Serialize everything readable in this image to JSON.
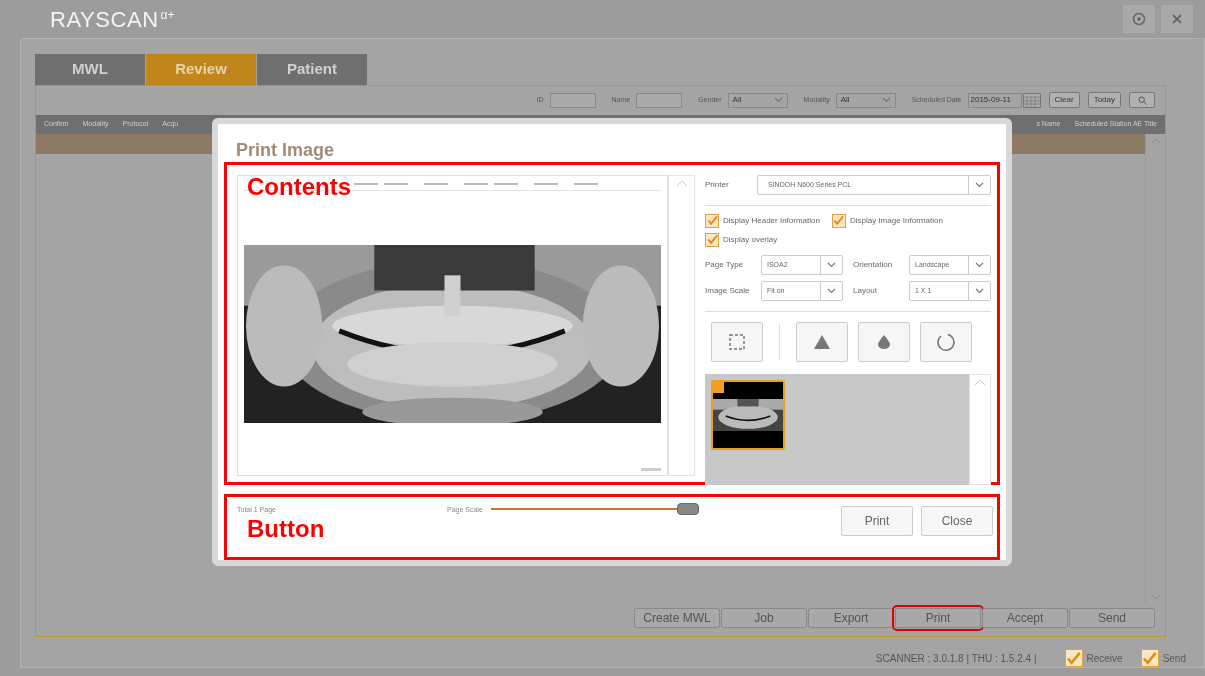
{
  "app": {
    "logo": "RAYSCAN",
    "logo_suffix": "α+"
  },
  "tabs": [
    {
      "label": "MWL",
      "selected": false
    },
    {
      "label": "Review",
      "selected": true
    },
    {
      "label": "Patient",
      "selected": false
    }
  ],
  "filters": [
    {
      "kind": "input",
      "label": "ID"
    },
    {
      "kind": "input",
      "label": "Name"
    },
    {
      "kind": "select",
      "label": "Gender",
      "value": "All"
    },
    {
      "kind": "select",
      "label": "Modality",
      "value": "All"
    },
    {
      "kind": "date",
      "label": "Scheduled Date",
      "value": "2015-09-11"
    }
  ],
  "filter_buttons": [
    "Clear",
    "Today"
  ],
  "table": {
    "columns_left": [
      "Confirm",
      "Modality",
      "Protocol",
      "Acqu"
    ],
    "columns_right": [
      "s Name",
      "Scheduled Station AE Title"
    ]
  },
  "action_buttons": [
    {
      "label": "Create MWL",
      "highlighted": false
    },
    {
      "label": "Job",
      "highlighted": false
    },
    {
      "label": "Export",
      "highlighted": false
    },
    {
      "label": "Print",
      "highlighted": true
    },
    {
      "label": "Accept",
      "highlighted": false
    },
    {
      "label": "Send",
      "highlighted": false
    }
  ],
  "status": {
    "version": "SCANNER : 3.0.1.8 | THU : 1.5.2.4 |",
    "checks": [
      {
        "label": "Receive",
        "checked": true
      },
      {
        "label": "Send",
        "checked": true
      }
    ]
  },
  "dialog": {
    "title": "Print Image",
    "printer": {
      "label": "Printer",
      "value": "SINDOH N600 Series PCL"
    },
    "options": [
      {
        "label": "Display Header Information",
        "checked": true
      },
      {
        "label": "Display Image Information",
        "checked": true
      },
      {
        "label": "Display overlay",
        "checked": true
      }
    ],
    "settings": [
      {
        "label": "Page Type",
        "value": "ISOA2"
      },
      {
        "label": "Orientation",
        "value": "Landscape"
      },
      {
        "label": "Image Scale",
        "value": "Fit on"
      },
      {
        "label": "Layout",
        "value": "1 X 1"
      }
    ],
    "thumbnails": [
      {
        "selected": true
      }
    ],
    "total": "Total 1 Page",
    "page_scale": {
      "label": "Page Scale",
      "level": 0.96
    },
    "buttons": [
      "Print",
      "Close"
    ]
  },
  "annotations": [
    {
      "label": "Contents"
    },
    {
      "label": "Button"
    }
  ]
}
